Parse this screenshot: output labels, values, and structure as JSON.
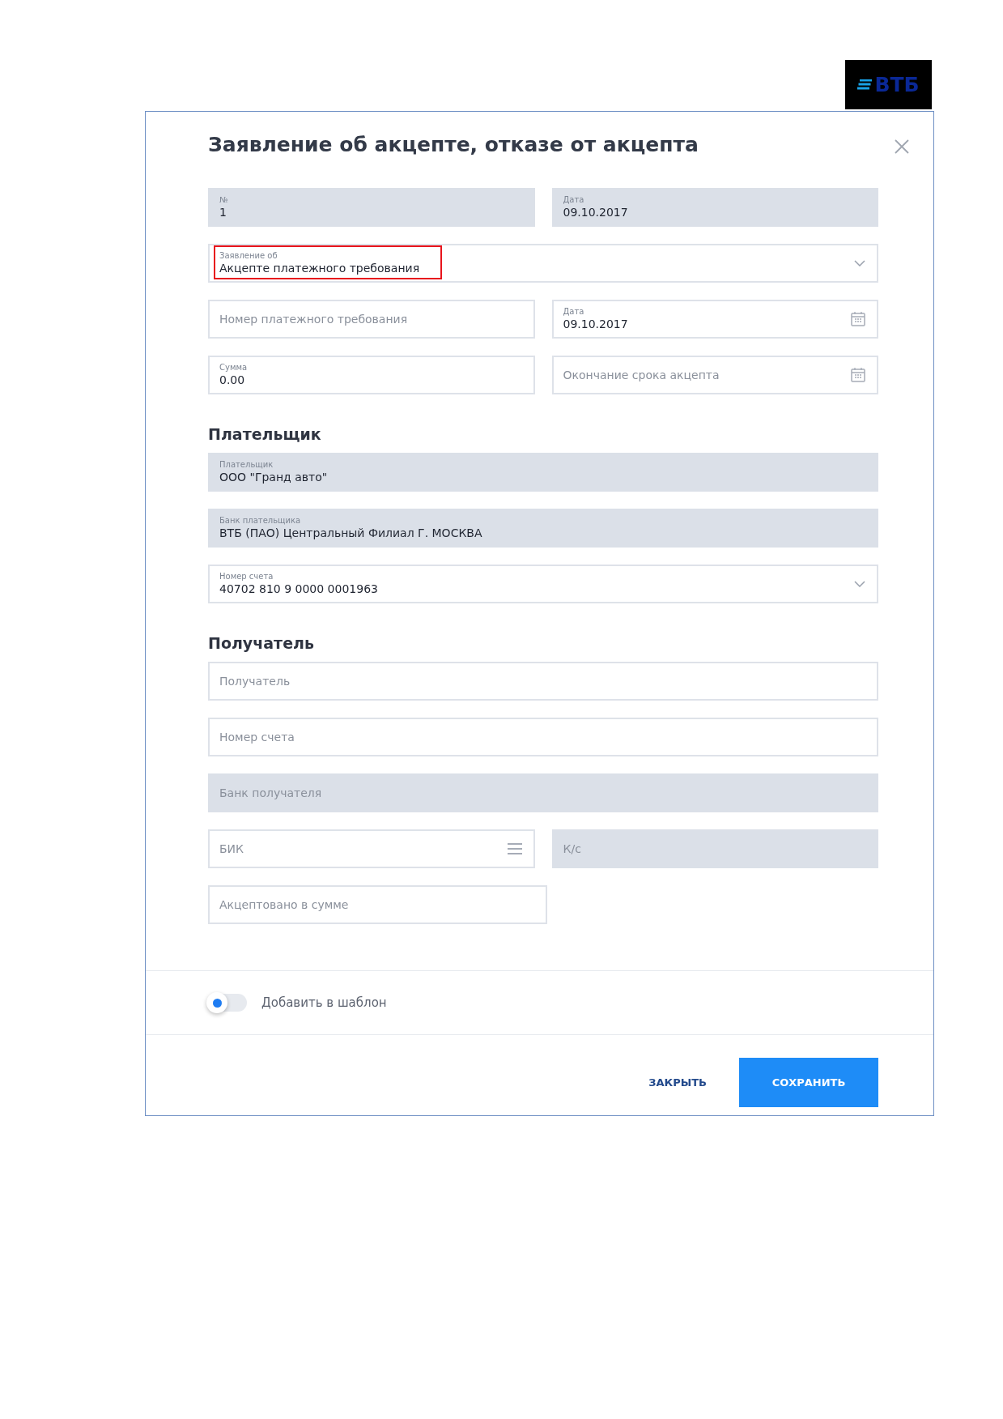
{
  "logo": {
    "text": "ВТБ"
  },
  "dialog": {
    "title": "Заявление об акцепте, отказе от акцепта",
    "sections": [
      {
        "rows": [
          [
            {
              "kind": "readonly",
              "label": "№",
              "value": "1",
              "highlighted": false
            },
            {
              "kind": "readonly",
              "label": "Дата",
              "value": "09.10.2017",
              "highlighted": false
            }
          ],
          [
            {
              "kind": "select",
              "label": "Заявление об",
              "value": "Акцепте платежного требования",
              "highlighted": true
            }
          ],
          [
            {
              "kind": "input",
              "placeholder": "Номер платежного требования",
              "highlighted": false
            },
            {
              "kind": "date",
              "label": "Дата",
              "value": "09.10.2017",
              "highlighted": false
            }
          ],
          [
            {
              "kind": "input",
              "label": "Сумма",
              "value": "0.00",
              "highlighted": false
            },
            {
              "kind": "date",
              "placeholder": "Окончание срока акцепта",
              "highlighted": false
            }
          ]
        ]
      },
      {
        "heading": "Плательщик",
        "rows": [
          [
            {
              "kind": "readonly",
              "label": "Плательщик",
              "value": "ООО  \"Гранд авто\"",
              "highlighted": false
            }
          ],
          [
            {
              "kind": "readonly",
              "label": "Банк плательщика",
              "value": "ВТБ (ПАО) Центральный Филиал Г. МОСКВА",
              "highlighted": false
            }
          ],
          [
            {
              "kind": "select",
              "label": "Номер счета",
              "value": "40702 810 9 0000 0001963",
              "highlighted": false
            }
          ]
        ]
      },
      {
        "heading": "Получатель",
        "rows": [
          [
            {
              "kind": "input",
              "placeholder": "Получатель",
              "highlighted": false
            }
          ],
          [
            {
              "kind": "input",
              "placeholder": "Номер счета",
              "highlighted": false
            }
          ],
          [
            {
              "kind": "readonly",
              "placeholder": "Банк получателя",
              "highlighted": false
            }
          ],
          [
            {
              "kind": "lookup",
              "placeholder": "БИК",
              "highlighted": false
            },
            {
              "kind": "readonly",
              "placeholder": "К/с",
              "highlighted": false
            }
          ],
          [
            {
              "kind": "input",
              "placeholder": "Акцептовано в сумме",
              "highlighted": false
            },
            {
              "kind": "spacer"
            }
          ]
        ]
      }
    ],
    "template_toggle": {
      "label": "Добавить в шаблон",
      "on": false
    },
    "buttons": [
      {
        "label": "ЗАКРЫТЬ",
        "kind": "secondary"
      },
      {
        "label": "СОХРАНИТЬ",
        "kind": "primary"
      }
    ]
  }
}
